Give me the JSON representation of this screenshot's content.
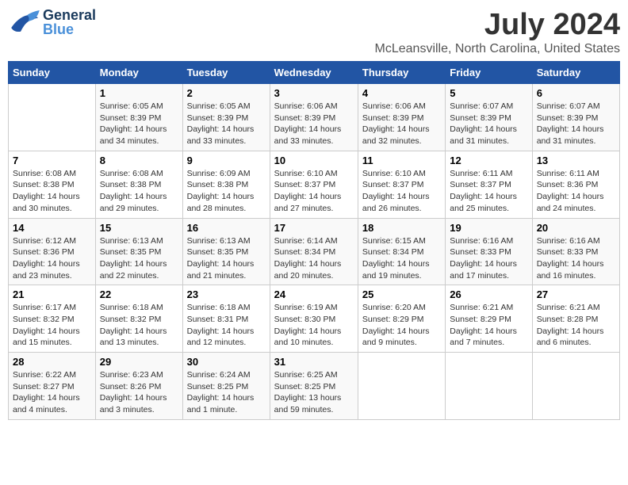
{
  "header": {
    "logo_general": "General",
    "logo_blue": "Blue",
    "month": "July 2024",
    "location": "McLeansville, North Carolina, United States"
  },
  "weekdays": [
    "Sunday",
    "Monday",
    "Tuesday",
    "Wednesday",
    "Thursday",
    "Friday",
    "Saturday"
  ],
  "weeks": [
    [
      {
        "day": "",
        "info": ""
      },
      {
        "day": "1",
        "info": "Sunrise: 6:05 AM\nSunset: 8:39 PM\nDaylight: 14 hours\nand 34 minutes."
      },
      {
        "day": "2",
        "info": "Sunrise: 6:05 AM\nSunset: 8:39 PM\nDaylight: 14 hours\nand 33 minutes."
      },
      {
        "day": "3",
        "info": "Sunrise: 6:06 AM\nSunset: 8:39 PM\nDaylight: 14 hours\nand 33 minutes."
      },
      {
        "day": "4",
        "info": "Sunrise: 6:06 AM\nSunset: 8:39 PM\nDaylight: 14 hours\nand 32 minutes."
      },
      {
        "day": "5",
        "info": "Sunrise: 6:07 AM\nSunset: 8:39 PM\nDaylight: 14 hours\nand 31 minutes."
      },
      {
        "day": "6",
        "info": "Sunrise: 6:07 AM\nSunset: 8:39 PM\nDaylight: 14 hours\nand 31 minutes."
      }
    ],
    [
      {
        "day": "7",
        "info": "Sunrise: 6:08 AM\nSunset: 8:38 PM\nDaylight: 14 hours\nand 30 minutes."
      },
      {
        "day": "8",
        "info": "Sunrise: 6:08 AM\nSunset: 8:38 PM\nDaylight: 14 hours\nand 29 minutes."
      },
      {
        "day": "9",
        "info": "Sunrise: 6:09 AM\nSunset: 8:38 PM\nDaylight: 14 hours\nand 28 minutes."
      },
      {
        "day": "10",
        "info": "Sunrise: 6:10 AM\nSunset: 8:37 PM\nDaylight: 14 hours\nand 27 minutes."
      },
      {
        "day": "11",
        "info": "Sunrise: 6:10 AM\nSunset: 8:37 PM\nDaylight: 14 hours\nand 26 minutes."
      },
      {
        "day": "12",
        "info": "Sunrise: 6:11 AM\nSunset: 8:37 PM\nDaylight: 14 hours\nand 25 minutes."
      },
      {
        "day": "13",
        "info": "Sunrise: 6:11 AM\nSunset: 8:36 PM\nDaylight: 14 hours\nand 24 minutes."
      }
    ],
    [
      {
        "day": "14",
        "info": "Sunrise: 6:12 AM\nSunset: 8:36 PM\nDaylight: 14 hours\nand 23 minutes."
      },
      {
        "day": "15",
        "info": "Sunrise: 6:13 AM\nSunset: 8:35 PM\nDaylight: 14 hours\nand 22 minutes."
      },
      {
        "day": "16",
        "info": "Sunrise: 6:13 AM\nSunset: 8:35 PM\nDaylight: 14 hours\nand 21 minutes."
      },
      {
        "day": "17",
        "info": "Sunrise: 6:14 AM\nSunset: 8:34 PM\nDaylight: 14 hours\nand 20 minutes."
      },
      {
        "day": "18",
        "info": "Sunrise: 6:15 AM\nSunset: 8:34 PM\nDaylight: 14 hours\nand 19 minutes."
      },
      {
        "day": "19",
        "info": "Sunrise: 6:16 AM\nSunset: 8:33 PM\nDaylight: 14 hours\nand 17 minutes."
      },
      {
        "day": "20",
        "info": "Sunrise: 6:16 AM\nSunset: 8:33 PM\nDaylight: 14 hours\nand 16 minutes."
      }
    ],
    [
      {
        "day": "21",
        "info": "Sunrise: 6:17 AM\nSunset: 8:32 PM\nDaylight: 14 hours\nand 15 minutes."
      },
      {
        "day": "22",
        "info": "Sunrise: 6:18 AM\nSunset: 8:32 PM\nDaylight: 14 hours\nand 13 minutes."
      },
      {
        "day": "23",
        "info": "Sunrise: 6:18 AM\nSunset: 8:31 PM\nDaylight: 14 hours\nand 12 minutes."
      },
      {
        "day": "24",
        "info": "Sunrise: 6:19 AM\nSunset: 8:30 PM\nDaylight: 14 hours\nand 10 minutes."
      },
      {
        "day": "25",
        "info": "Sunrise: 6:20 AM\nSunset: 8:29 PM\nDaylight: 14 hours\nand 9 minutes."
      },
      {
        "day": "26",
        "info": "Sunrise: 6:21 AM\nSunset: 8:29 PM\nDaylight: 14 hours\nand 7 minutes."
      },
      {
        "day": "27",
        "info": "Sunrise: 6:21 AM\nSunset: 8:28 PM\nDaylight: 14 hours\nand 6 minutes."
      }
    ],
    [
      {
        "day": "28",
        "info": "Sunrise: 6:22 AM\nSunset: 8:27 PM\nDaylight: 14 hours\nand 4 minutes."
      },
      {
        "day": "29",
        "info": "Sunrise: 6:23 AM\nSunset: 8:26 PM\nDaylight: 14 hours\nand 3 minutes."
      },
      {
        "day": "30",
        "info": "Sunrise: 6:24 AM\nSunset: 8:25 PM\nDaylight: 14 hours\nand 1 minute."
      },
      {
        "day": "31",
        "info": "Sunrise: 6:25 AM\nSunset: 8:25 PM\nDaylight: 13 hours\nand 59 minutes."
      },
      {
        "day": "",
        "info": ""
      },
      {
        "day": "",
        "info": ""
      },
      {
        "day": "",
        "info": ""
      }
    ]
  ]
}
